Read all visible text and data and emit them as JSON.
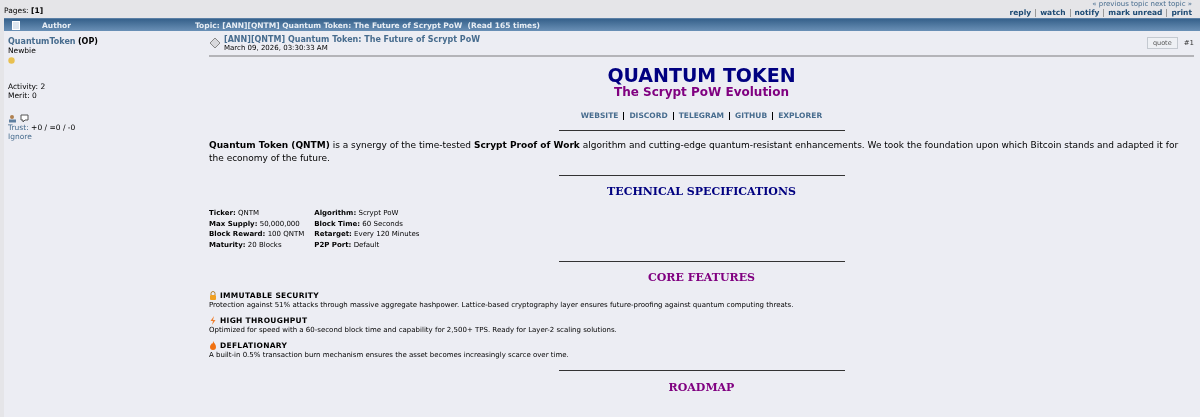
{
  "top_nav": {
    "prev_next": "« previous topic next topic »",
    "actions": [
      "reply",
      "watch",
      "notify",
      "mark unread",
      "print"
    ]
  },
  "pages": {
    "label": "Pages:",
    "current": "[1]"
  },
  "header": {
    "author": "Author",
    "topic": "Topic: [ANN][QNTM] Quantum Token: The Future of Scrypt PoW  (Read 165 times)"
  },
  "author": {
    "name": "QuantumToken",
    "op": "(OP)",
    "rank": "Newbie",
    "activity": "Activity: 2",
    "merit": "Merit: 0",
    "trust_label": "Trust:",
    "trust": "+0 / =0 / -0",
    "ignore": "Ignore"
  },
  "post": {
    "title": "[ANN][QNTM] Quantum Token: The Future of Scrypt PoW",
    "date": "March 09, 2026, 03:30:33 AM",
    "quote": "quote",
    "number": "#1",
    "heading": "QUANTUM TOKEN",
    "subheading": "The Scrypt PoW Evolution",
    "links": [
      "WEBSITE",
      "DISCORD",
      "TELEGRAM",
      "GITHUB",
      "EXPLORER"
    ],
    "intro": "**Quantum Token (QNTM)** is a synergy of the time-tested **Scrypt Proof of Work** algorithm and cutting-edge quantum-resistant enhancements. We took the foundation upon which Bitcoin stands and adapted it for the economy of the future.",
    "specs_title": "TECHNICAL SPECIFICATIONS",
    "specs": [
      [
        {
          "label": "Ticker:",
          "value": "QNTM"
        },
        {
          "label": "Max Supply:",
          "value": "50,000,000"
        },
        {
          "label": "Block Reward:",
          "value": "100 QNTM"
        },
        {
          "label": "Maturity:",
          "value": "20 Blocks"
        }
      ],
      [
        {
          "label": "Algorithm:",
          "value": "Scrypt PoW"
        },
        {
          "label": "Block Time:",
          "value": "60 Seconds"
        },
        {
          "label": "Retarget:",
          "value": "Every 120 Minutes"
        },
        {
          "label": "P2P Port:",
          "value": "Default"
        }
      ]
    ],
    "features_title": "CORE FEATURES",
    "features": [
      {
        "kind": "lock",
        "title": "IMMUTABLE SECURITY",
        "text": "Protection against 51% attacks through massive aggregate hashpower. Lattice-based cryptography layer ensures future-proofing against quantum computing threats."
      },
      {
        "kind": "bolt",
        "title": "HIGH THROUGHPUT",
        "text": "Optimized for speed with a 60-second block time and capability for 2,500+ TPS. Ready for Layer-2 scaling solutions."
      },
      {
        "kind": "fire",
        "title": "DEFLATIONARY",
        "text": "A built-in 0.5% transaction burn mechanism ensures the asset becomes increasingly scarce over time."
      }
    ],
    "roadmap_title": "ROADMAP"
  }
}
